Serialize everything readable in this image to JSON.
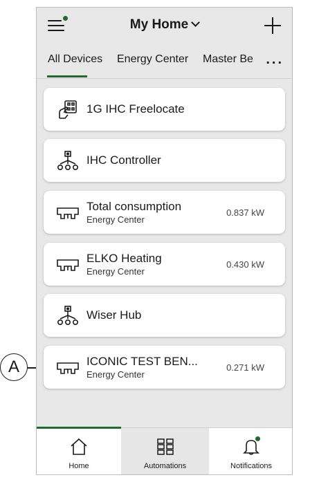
{
  "header": {
    "title": "My Home",
    "menu_icon": "menu-icon",
    "add_icon": "plus-icon"
  },
  "tabs": [
    {
      "label": "All Devices",
      "active": true
    },
    {
      "label": "Energy Center",
      "active": false
    },
    {
      "label": "Master Be",
      "active": false
    }
  ],
  "tabs_more": "...",
  "devices": [
    {
      "name": "1G IHC Freelocate",
      "subtitle": "",
      "value": "",
      "icon": "tap-remote-icon"
    },
    {
      "name": "IHC Controller",
      "subtitle": "",
      "value": "",
      "icon": "network-hub-icon"
    },
    {
      "name": "Total consumption",
      "subtitle": "Energy Center",
      "value": "0.837 kW",
      "icon": "energy-meter-icon"
    },
    {
      "name": "ELKO Heating",
      "subtitle": "Energy Center",
      "value": "0.430 kW",
      "icon": "energy-meter-icon"
    },
    {
      "name": "Wiser Hub",
      "subtitle": "",
      "value": "",
      "icon": "network-hub-icon"
    },
    {
      "name": "ICONIC TEST BEN...",
      "subtitle": "Energy Center",
      "value": "0.271 kW",
      "icon": "energy-meter-icon"
    }
  ],
  "bottom_nav": {
    "home": {
      "label": "Home",
      "icon": "home-icon"
    },
    "automations": {
      "label": "Automations",
      "icon": "grid-icon"
    },
    "notifications": {
      "label": "Notifications",
      "icon": "bell-icon"
    }
  },
  "callout": {
    "letter": "A"
  },
  "colors": {
    "accent": "#1e6b2c",
    "status_dot": "#1e6b2c",
    "background": "#e8e8e8",
    "card": "#ffffff"
  }
}
